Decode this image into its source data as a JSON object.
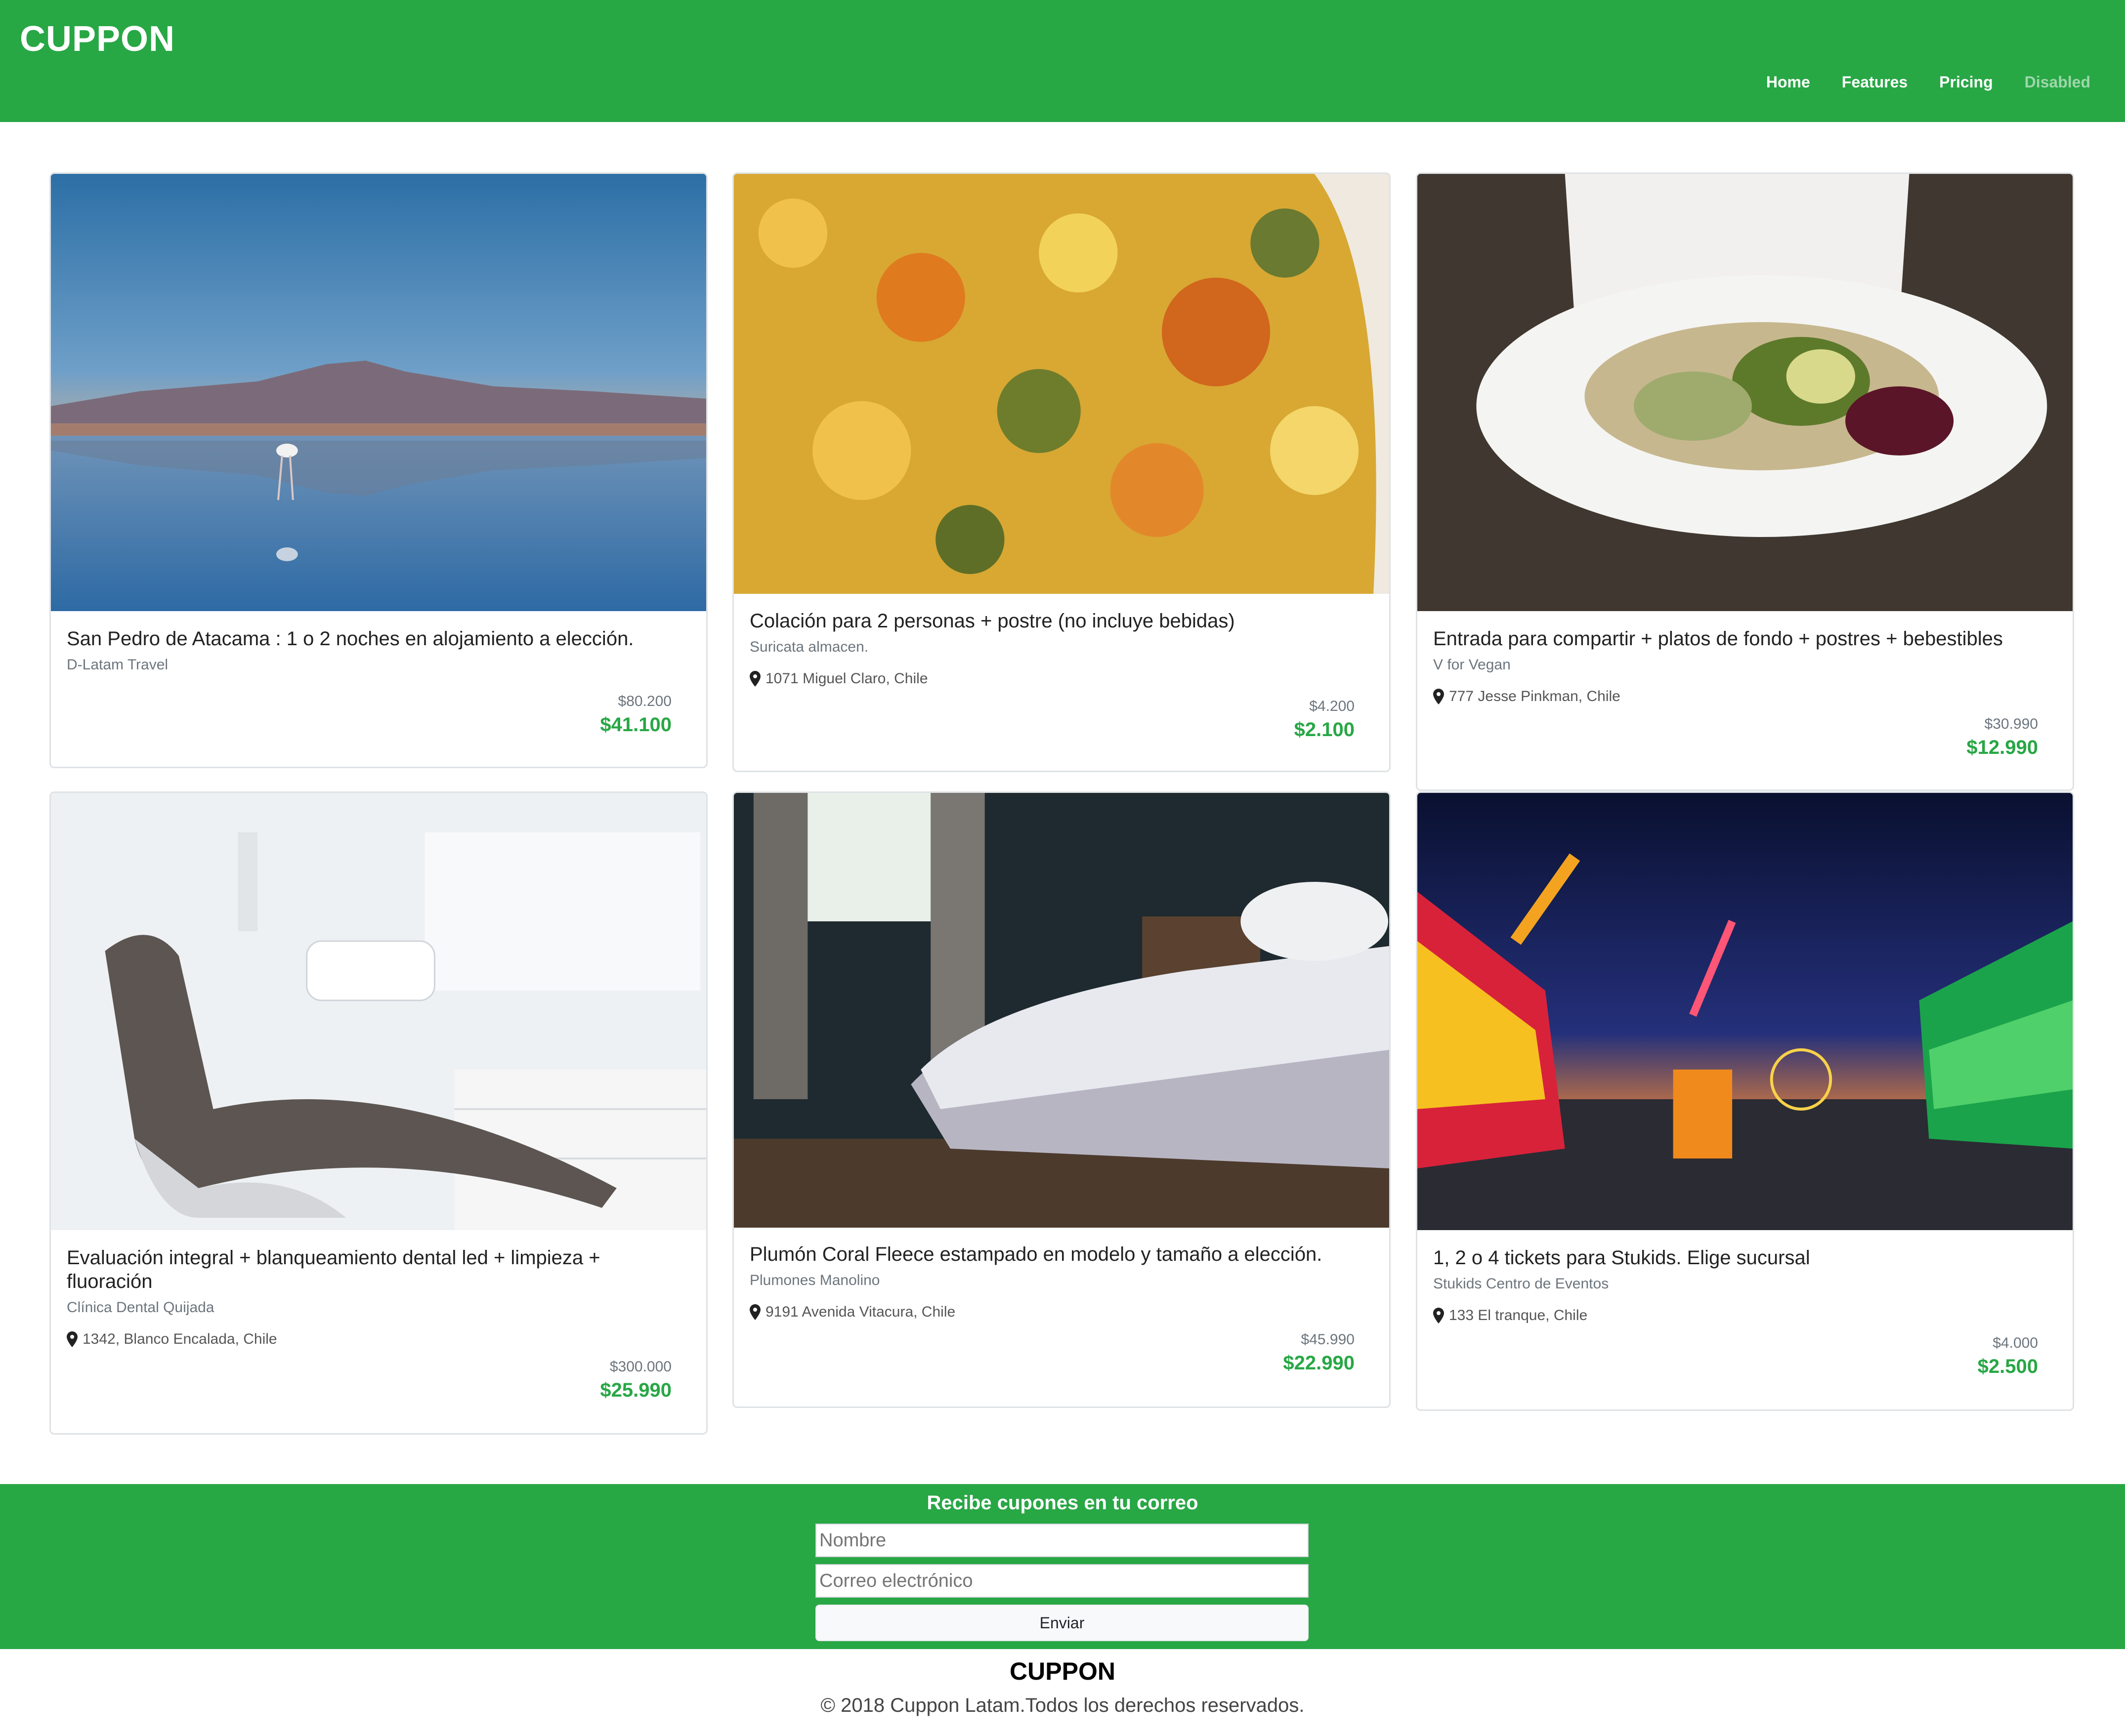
{
  "header": {
    "brand": "CUPPON",
    "nav": [
      {
        "label": "Home"
      },
      {
        "label": "Features"
      },
      {
        "label": "Pricing"
      },
      {
        "label": "Disabled"
      }
    ]
  },
  "cards": [
    {
      "title": "San Pedro de Atacama : 1 o 2 noches en alojamiento a elección.",
      "provider": "D-Latam Travel",
      "address": "",
      "old_price": "$80.200",
      "new_price": "$41.100"
    },
    {
      "title": "Colación para 2 personas + postre (no incluye bebidas)",
      "provider": "Suricata almacen.",
      "address": "1071 Miguel Claro, Chile",
      "old_price": "$4.200",
      "new_price": "$2.100"
    },
    {
      "title": "Entrada para compartir + platos de fondo + postres + bebestibles",
      "provider": "V for Vegan",
      "address": "777 Jesse Pinkman, Chile",
      "old_price": "$30.990",
      "new_price": "$12.990"
    },
    {
      "title": "Evaluación integral + blanqueamiento dental led + limpieza + fluoración",
      "provider": "Clínica Dental Quijada",
      "address": "1342, Blanco Encalada, Chile",
      "old_price": "$300.000",
      "new_price": "$25.990"
    },
    {
      "title": "Plumón Coral Fleece estampado en modelo y tamaño a elección.",
      "provider": "Plumones Manolino",
      "address": "9191 Avenida Vitacura, Chile",
      "old_price": "$45.990",
      "new_price": "$22.990"
    },
    {
      "title": "1, 2 o 4 tickets para Stukids. Elige sucursal",
      "provider": "Stukids Centro de Eventos",
      "address": "133 El tranque, Chile",
      "old_price": "$4.000",
      "new_price": "$2.500"
    }
  ],
  "newsletter": {
    "title": "Recibe cupones en tu correo",
    "name_placeholder": "Nombre",
    "email_placeholder": "Correo electrónico",
    "submit_label": "Enviar"
  },
  "footer": {
    "brand": "CUPPON",
    "copyright": "© 2018 Cuppon Latam.Todos los derechos reservados."
  },
  "colors": {
    "brand_green": "#28a745",
    "price_green": "#28a745"
  }
}
